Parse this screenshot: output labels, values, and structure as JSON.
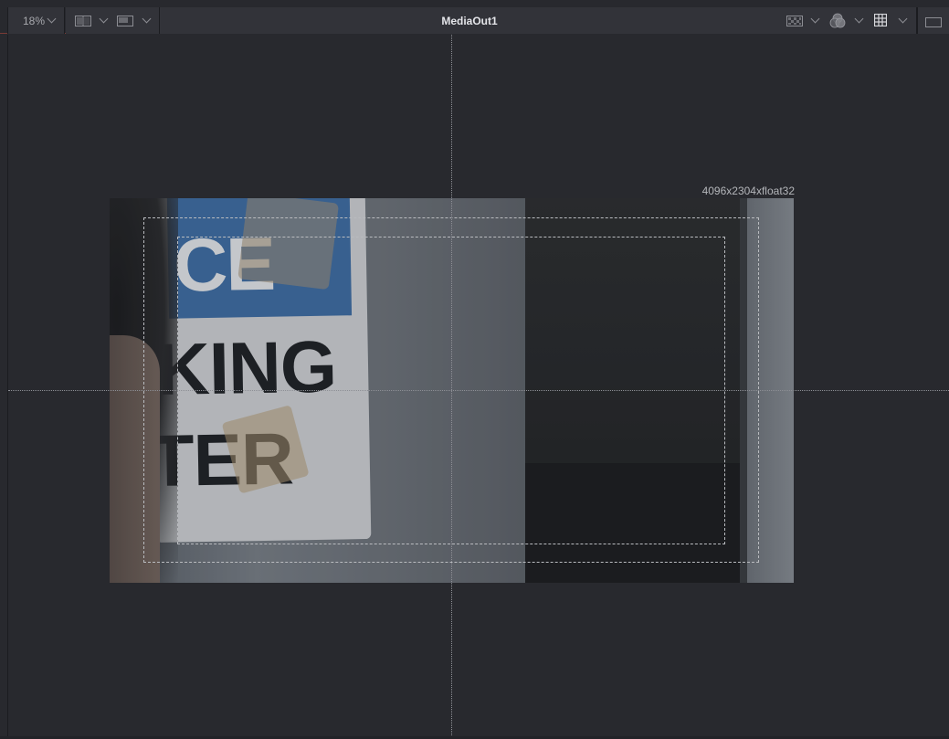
{
  "toolbar": {
    "zoom_label": "18%",
    "title": "MediaOut1"
  },
  "canvas": {
    "resolution_label": "4096x2304xfloat32",
    "image_content": {
      "sign_word_1": "CE",
      "sign_word_2": "KING",
      "sign_word_3": "TER"
    }
  },
  "icons": {
    "zoom_dropdown": "chevron-down-icon",
    "viewer_layout": "split-view-icon",
    "viewer_layout_dropdown": "chevron-down-icon",
    "view_mode": "single-view-icon",
    "view_mode_dropdown": "chevron-down-icon",
    "checker": "checkerboard-icon",
    "checker_dropdown": "chevron-down-icon",
    "color_channels": "rgb-channels-icon",
    "color_channels_dropdown": "chevron-down-icon",
    "grid": "grid-icon",
    "grid_dropdown": "chevron-down-icon",
    "viewer_mode": "single-viewer-icon"
  },
  "colors": {
    "background": "#28292e",
    "toolbar_accent": "#7a3a36",
    "guide": "#8d8f95"
  }
}
